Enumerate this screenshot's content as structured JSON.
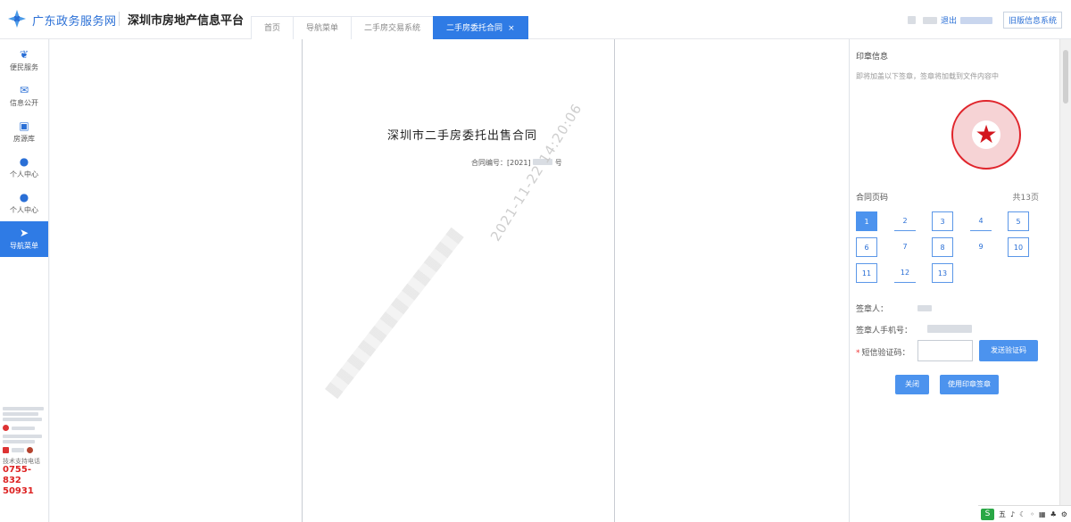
{
  "header": {
    "brand": "广东政务服务网",
    "platform": "深圳市房地产信息平台",
    "tabs": [
      {
        "label": "首页",
        "active": false
      },
      {
        "label": "导航菜单",
        "active": false
      },
      {
        "label": "二手房交易系统",
        "active": false
      },
      {
        "label": "二手房委托合同",
        "active": true
      }
    ],
    "tab_close": "×",
    "logout": "退出",
    "old_system": "旧版信息系统"
  },
  "sidebar": {
    "items": [
      {
        "label": "便民服务",
        "icon": "service-icon",
        "glyph": "❦",
        "active": false
      },
      {
        "label": "信息公开",
        "icon": "mail-icon",
        "glyph": "✉",
        "active": false
      },
      {
        "label": "房源库",
        "icon": "building-icon",
        "glyph": "▣",
        "active": false
      },
      {
        "label": "个人中心",
        "icon": "user-icon",
        "glyph": "●",
        "active": false
      },
      {
        "label": "个人中心",
        "icon": "user-icon",
        "glyph": "●",
        "active": false
      },
      {
        "label": "导航菜单",
        "icon": "navigation-icon",
        "glyph": "➤",
        "active": true
      }
    ],
    "hotline_label": "技术支持电话",
    "hotline_line1": "0755-832",
    "hotline_line2": "50931"
  },
  "document": {
    "title": "深圳市二手房委托出售合同",
    "contract_no": "合同编号：[2021]",
    "contract_no_suffix": "号",
    "watermark": "2021-11-22 14:20:06"
  },
  "panel": {
    "title": "印章信息",
    "hint": "即将加盖以下签章，签章将加载到文件内容中",
    "pages_label": "合同页码",
    "pages_total": "共13页",
    "pages": [
      "1",
      "2",
      "3",
      "4",
      "5",
      "6",
      "7",
      "8",
      "9",
      "10",
      "11",
      "12",
      "13"
    ],
    "active_page": "1",
    "signer_label": "签章人：",
    "phone_label": "签章人手机号：",
    "code_label": "短信验证码：",
    "code_placeholder": "",
    "send_code_button": "发送验证码",
    "close_button": "关闭",
    "sign_button": "使用印章签章",
    "seal_color": "#e0252c",
    "accent_color": "#2f7be5"
  },
  "tray": {
    "logo": "S",
    "items": [
      "五",
      "♪",
      "☾",
      "◦",
      "▦",
      "♣",
      "⚙"
    ]
  }
}
